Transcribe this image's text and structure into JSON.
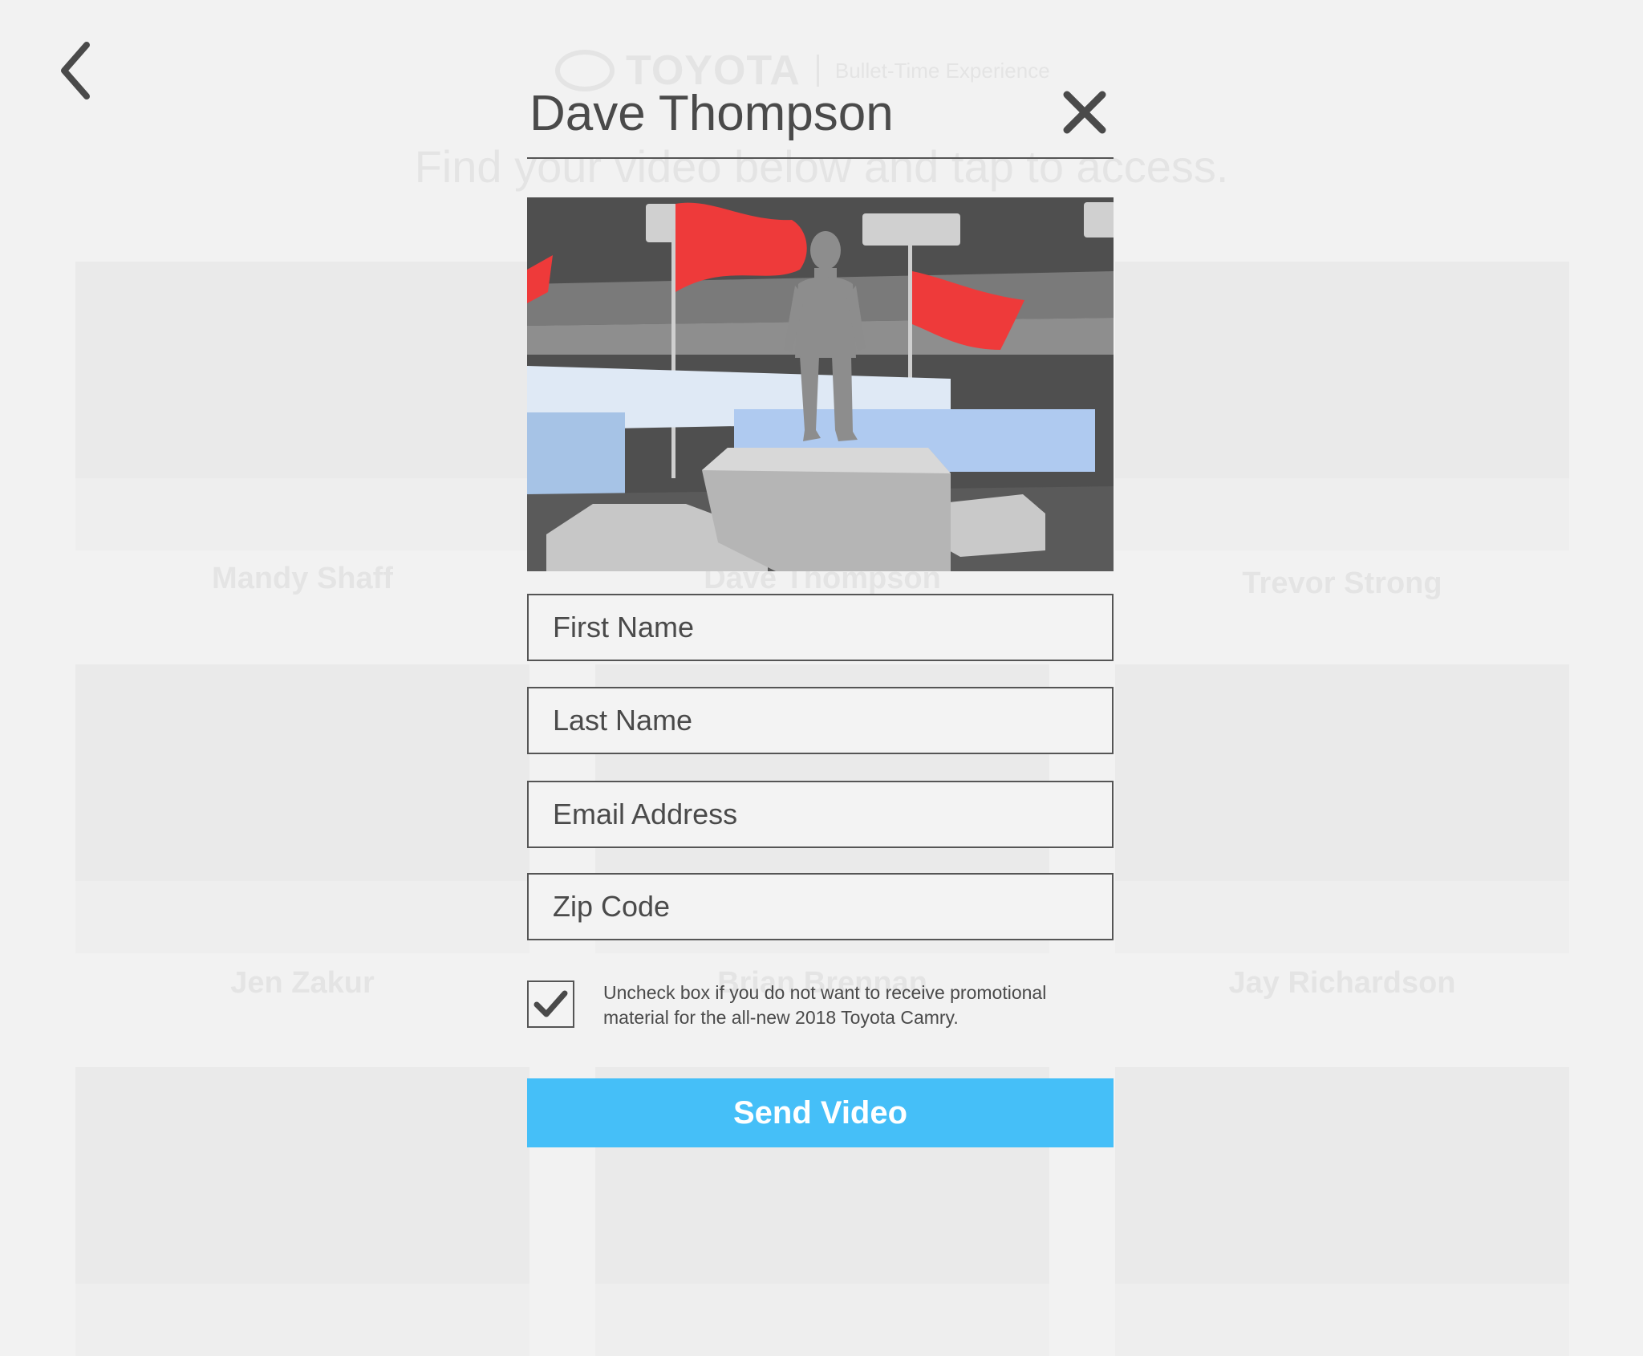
{
  "background": {
    "brand": "TOYOTA",
    "tagline": "Bullet-Time Experience",
    "heading": "Find your video below and tap to access.",
    "videos": [
      {
        "name": "Mandy Shaff"
      },
      {
        "name": "Dave Thompson"
      },
      {
        "name": "Trevor Strong"
      },
      {
        "name": "Jen Zakur"
      },
      {
        "name": "Brian Brennan"
      },
      {
        "name": "Jay Richardson"
      }
    ]
  },
  "modal": {
    "title": "Dave Thompson",
    "fields": {
      "first_name": {
        "placeholder": "First Name",
        "value": ""
      },
      "last_name": {
        "placeholder": "Last Name",
        "value": ""
      },
      "email": {
        "placeholder": "Email Address",
        "value": ""
      },
      "zip": {
        "placeholder": "Zip Code",
        "value": ""
      }
    },
    "consent": {
      "checked": true,
      "text": "Uncheck box if you do not want to receive promotional material for the all-new 2018 Toyota Camry."
    },
    "submit_label": "Send Video"
  },
  "icons": {
    "back": "chevron-left-icon",
    "close": "close-icon",
    "check": "checkmark-icon"
  },
  "colors": {
    "background": "#f2f2f2",
    "text": "#4a4a4a",
    "border": "#555555",
    "accent": "#45bff8",
    "flag": "#ee3a3a"
  }
}
